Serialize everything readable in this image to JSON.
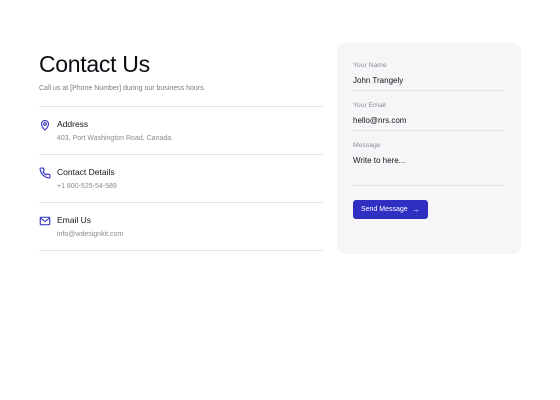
{
  "contact": {
    "title": "Contact Us",
    "subtitle": "Call us at [Phone Number] during our business hours.",
    "items": [
      {
        "icon": "location-pin-icon",
        "title": "Address",
        "value": "403, Port Washington Road, Canada."
      },
      {
        "icon": "phone-icon",
        "title": "Contact Details",
        "value": "+1 800-525-54-589"
      },
      {
        "icon": "mail-icon",
        "title": "Email Us",
        "value": "info@wdesignkit.com"
      }
    ]
  },
  "form": {
    "name_label": "Your Name",
    "name_value": "John Trangely",
    "email_label": "Your Email",
    "email_value": "hello@nrs.com",
    "message_label": "Message",
    "message_placeholder": "Write to here...",
    "submit_label": "Send Message",
    "submit_icon": "arrow-right-icon"
  },
  "colors": {
    "accent": "#2f2fc2",
    "card_background": "#f6f6f8"
  }
}
